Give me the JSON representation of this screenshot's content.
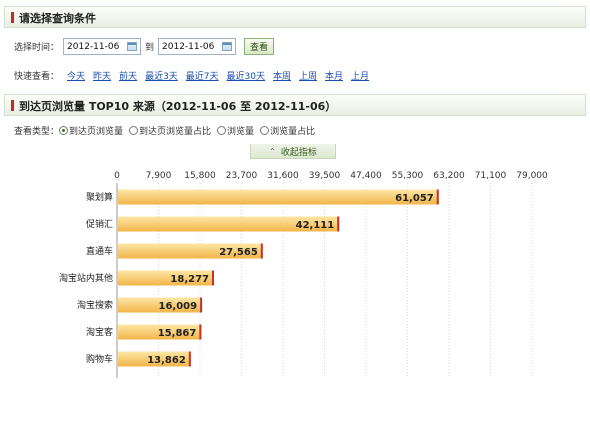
{
  "query_panel": {
    "title": "请选择查询条件",
    "time_label": "选择时间：",
    "start_date": "2012-11-06",
    "to_label": "到",
    "end_date": "2012-11-06",
    "query_button": "查看",
    "quick_label": "快速查看：",
    "quick_links": [
      "今天",
      "昨天",
      "前天",
      "最近3天",
      "最近7天",
      "最近30天",
      "本周",
      "上周",
      "本月",
      "上月"
    ]
  },
  "report_panel": {
    "title": "到达页浏览量 TOP10 来源（2012-11-06 至 2012-11-06）",
    "view_type_label": "查看类型：",
    "view_types": [
      "到达页浏览量",
      "到达页浏览量占比",
      "浏览量",
      "浏览量占比"
    ],
    "selected_view_type": "到达页浏览量",
    "collapse_label": "收起指标"
  },
  "colors": {
    "bar_top": "#fde7a6",
    "bar_bottom": "#f2b449",
    "bar_edge": "#c9302c"
  },
  "chart_data": {
    "type": "bar",
    "orientation": "horizontal",
    "categories": [
      "聚划算",
      "促销汇",
      "直通车",
      "淘宝站内其他",
      "淘宝搜索",
      "淘宝客",
      "购物车"
    ],
    "values": [
      61057,
      42111,
      27565,
      18277,
      16009,
      15867,
      13862
    ],
    "value_labels": [
      "61,057",
      "42,111",
      "27,565",
      "18,277",
      "16,009",
      "15,867",
      "13,862"
    ],
    "x_ticks": [
      "0",
      "7,900",
      "15,800",
      "23,700",
      "31,600",
      "39,500",
      "47,400",
      "55,300",
      "63,200",
      "71,100",
      "79,000"
    ],
    "xlim": [
      0,
      79000
    ],
    "tick_step": 7900
  }
}
